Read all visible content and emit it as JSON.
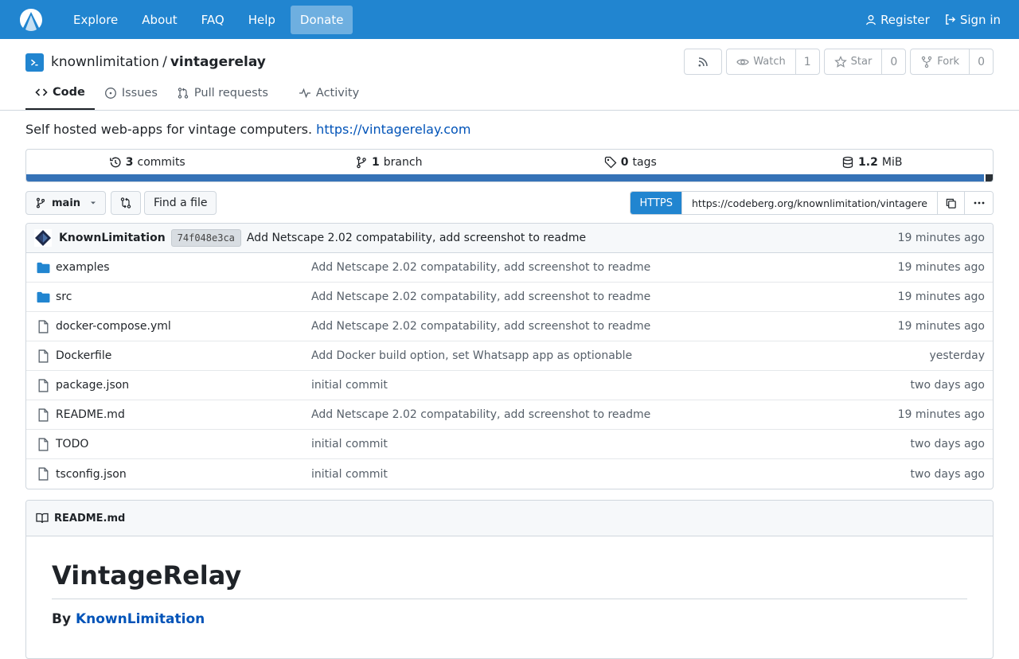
{
  "nav": {
    "items": [
      "Explore",
      "About",
      "FAQ",
      "Help"
    ],
    "donate": "Donate",
    "register": "Register",
    "signin": "Sign in"
  },
  "repo": {
    "owner": "knownlimitation",
    "separator": "/",
    "name": "vintagerelay",
    "watch_label": "Watch",
    "watch_count": "1",
    "star_label": "Star",
    "star_count": "0",
    "fork_label": "Fork",
    "fork_count": "0"
  },
  "tabs": [
    {
      "label": "Code",
      "icon": "code-icon",
      "active": true
    },
    {
      "label": "Issues",
      "icon": "issue-icon"
    },
    {
      "label": "Pull requests",
      "icon": "pull-request-icon"
    },
    {
      "label": "Activity",
      "icon": "pulse-icon"
    }
  ],
  "description": {
    "text": "Self hosted web-apps for vintage computers.",
    "link": "https://vintagerelay.com"
  },
  "stats": {
    "commits_count": "3",
    "commits_label": "commits",
    "branch_count": "1",
    "branch_label": "branch",
    "tags_count": "0",
    "tags_label": "tags",
    "size_value": "1.2",
    "size_unit": "MiB"
  },
  "toolbar": {
    "branch": "main",
    "find_file": "Find a file",
    "clone_protocol": "HTTPS",
    "clone_url": "https://codeberg.org/knownlimitation/vintagerelay.git"
  },
  "latest_commit": {
    "author": "KnownLimitation",
    "sha": "74f048e3ca",
    "message": "Add Netscape 2.02 compatability, add screenshot to readme",
    "time": "19 minutes ago"
  },
  "files": [
    {
      "name": "examples",
      "type": "folder",
      "message": "Add Netscape 2.02 compatability, add screenshot to readme",
      "time": "19 minutes ago"
    },
    {
      "name": "src",
      "type": "folder",
      "message": "Add Netscape 2.02 compatability, add screenshot to readme",
      "time": "19 minutes ago"
    },
    {
      "name": "docker-compose.yml",
      "type": "file",
      "message": "Add Netscape 2.02 compatability, add screenshot to readme",
      "time": "19 minutes ago"
    },
    {
      "name": "Dockerfile",
      "type": "file",
      "message": "Add Docker build option, set Whatsapp app as optionable",
      "time": "yesterday"
    },
    {
      "name": "package.json",
      "type": "file",
      "message": "initial commit",
      "time": "two days ago"
    },
    {
      "name": "README.md",
      "type": "file",
      "message": "Add Netscape 2.02 compatability, add screenshot to readme",
      "time": "19 minutes ago"
    },
    {
      "name": "TODO",
      "type": "file",
      "message": "initial commit",
      "time": "two days ago"
    },
    {
      "name": "tsconfig.json",
      "type": "file",
      "message": "initial commit",
      "time": "two days ago"
    }
  ],
  "readme": {
    "filename": "README.md",
    "title": "VintageRelay",
    "by": "By",
    "author": "KnownLimitation"
  },
  "colors": {
    "accent": "#2185d0",
    "link": "#0053b8",
    "lang_primary": "#3572b7",
    "lang_secondary": "#2b3137"
  }
}
